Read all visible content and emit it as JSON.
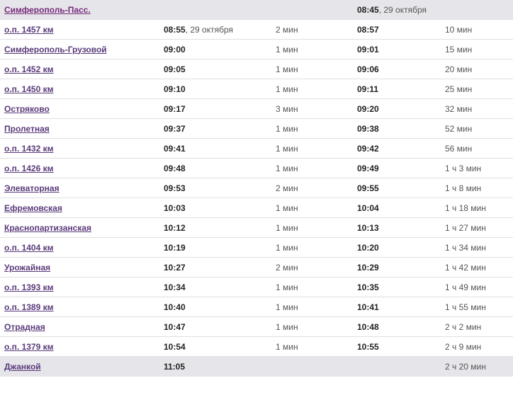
{
  "header": {
    "station": "Симферополь-Пасс.",
    "depart_time": "08:45",
    "depart_date": ", 29 октября"
  },
  "rows": [
    {
      "station": "о.п. 1457 км",
      "arr_time": "08:55",
      "arr_date": ", 29 октября",
      "stop": "2 мин",
      "dep": "08:57",
      "total": "10 мин"
    },
    {
      "station": "Симферополь-Грузовой",
      "arr_time": "09:00",
      "arr_date": "",
      "stop": "1 мин",
      "dep": "09:01",
      "total": "15 мин"
    },
    {
      "station": "о.п. 1452 км",
      "arr_time": "09:05",
      "arr_date": "",
      "stop": "1 мин",
      "dep": "09:06",
      "total": "20 мин"
    },
    {
      "station": "о.п. 1450 км",
      "arr_time": "09:10",
      "arr_date": "",
      "stop": "1 мин",
      "dep": "09:11",
      "total": "25 мин"
    },
    {
      "station": "Остряково",
      "arr_time": "09:17",
      "arr_date": "",
      "stop": "3 мин",
      "dep": "09:20",
      "total": "32 мин"
    },
    {
      "station": "Пролетная",
      "arr_time": "09:37",
      "arr_date": "",
      "stop": "1 мин",
      "dep": "09:38",
      "total": "52 мин"
    },
    {
      "station": "о.п. 1432 км",
      "arr_time": "09:41",
      "arr_date": "",
      "stop": "1 мин",
      "dep": "09:42",
      "total": "56 мин"
    },
    {
      "station": "о.п. 1426 км",
      "arr_time": "09:48",
      "arr_date": "",
      "stop": "1 мин",
      "dep": "09:49",
      "total": "1 ч 3 мин"
    },
    {
      "station": "Элеваторная",
      "arr_time": "09:53",
      "arr_date": "",
      "stop": "2 мин",
      "dep": "09:55",
      "total": "1 ч 8 мин"
    },
    {
      "station": "Ефремовская",
      "arr_time": "10:03",
      "arr_date": "",
      "stop": "1 мин",
      "dep": "10:04",
      "total": "1 ч 18 мин"
    },
    {
      "station": "Краснопартизанская",
      "arr_time": "10:12",
      "arr_date": "",
      "stop": "1 мин",
      "dep": "10:13",
      "total": "1 ч 27 мин"
    },
    {
      "station": "о.п. 1404 км",
      "arr_time": "10:19",
      "arr_date": "",
      "stop": "1 мин",
      "dep": "10:20",
      "total": "1 ч 34 мин"
    },
    {
      "station": "Урожайная",
      "arr_time": "10:27",
      "arr_date": "",
      "stop": "2 мин",
      "dep": "10:29",
      "total": "1 ч 42 мин"
    },
    {
      "station": "о.п. 1393 км",
      "arr_time": "10:34",
      "arr_date": "",
      "stop": "1 мин",
      "dep": "10:35",
      "total": "1 ч 49 мин"
    },
    {
      "station": "о.п. 1389 км",
      "arr_time": "10:40",
      "arr_date": "",
      "stop": "1 мин",
      "dep": "10:41",
      "total": "1 ч 55 мин"
    },
    {
      "station": "Отрадная",
      "arr_time": "10:47",
      "arr_date": "",
      "stop": "1 мин",
      "dep": "10:48",
      "total": "2 ч 2 мин"
    },
    {
      "station": "о.п. 1379 км",
      "arr_time": "10:54",
      "arr_date": "",
      "stop": "1 мин",
      "dep": "10:55",
      "total": "2 ч 9 мин"
    }
  ],
  "footer": {
    "station": "Джанкой",
    "arr_time": "11:05",
    "total": "2 ч 20 мин"
  }
}
